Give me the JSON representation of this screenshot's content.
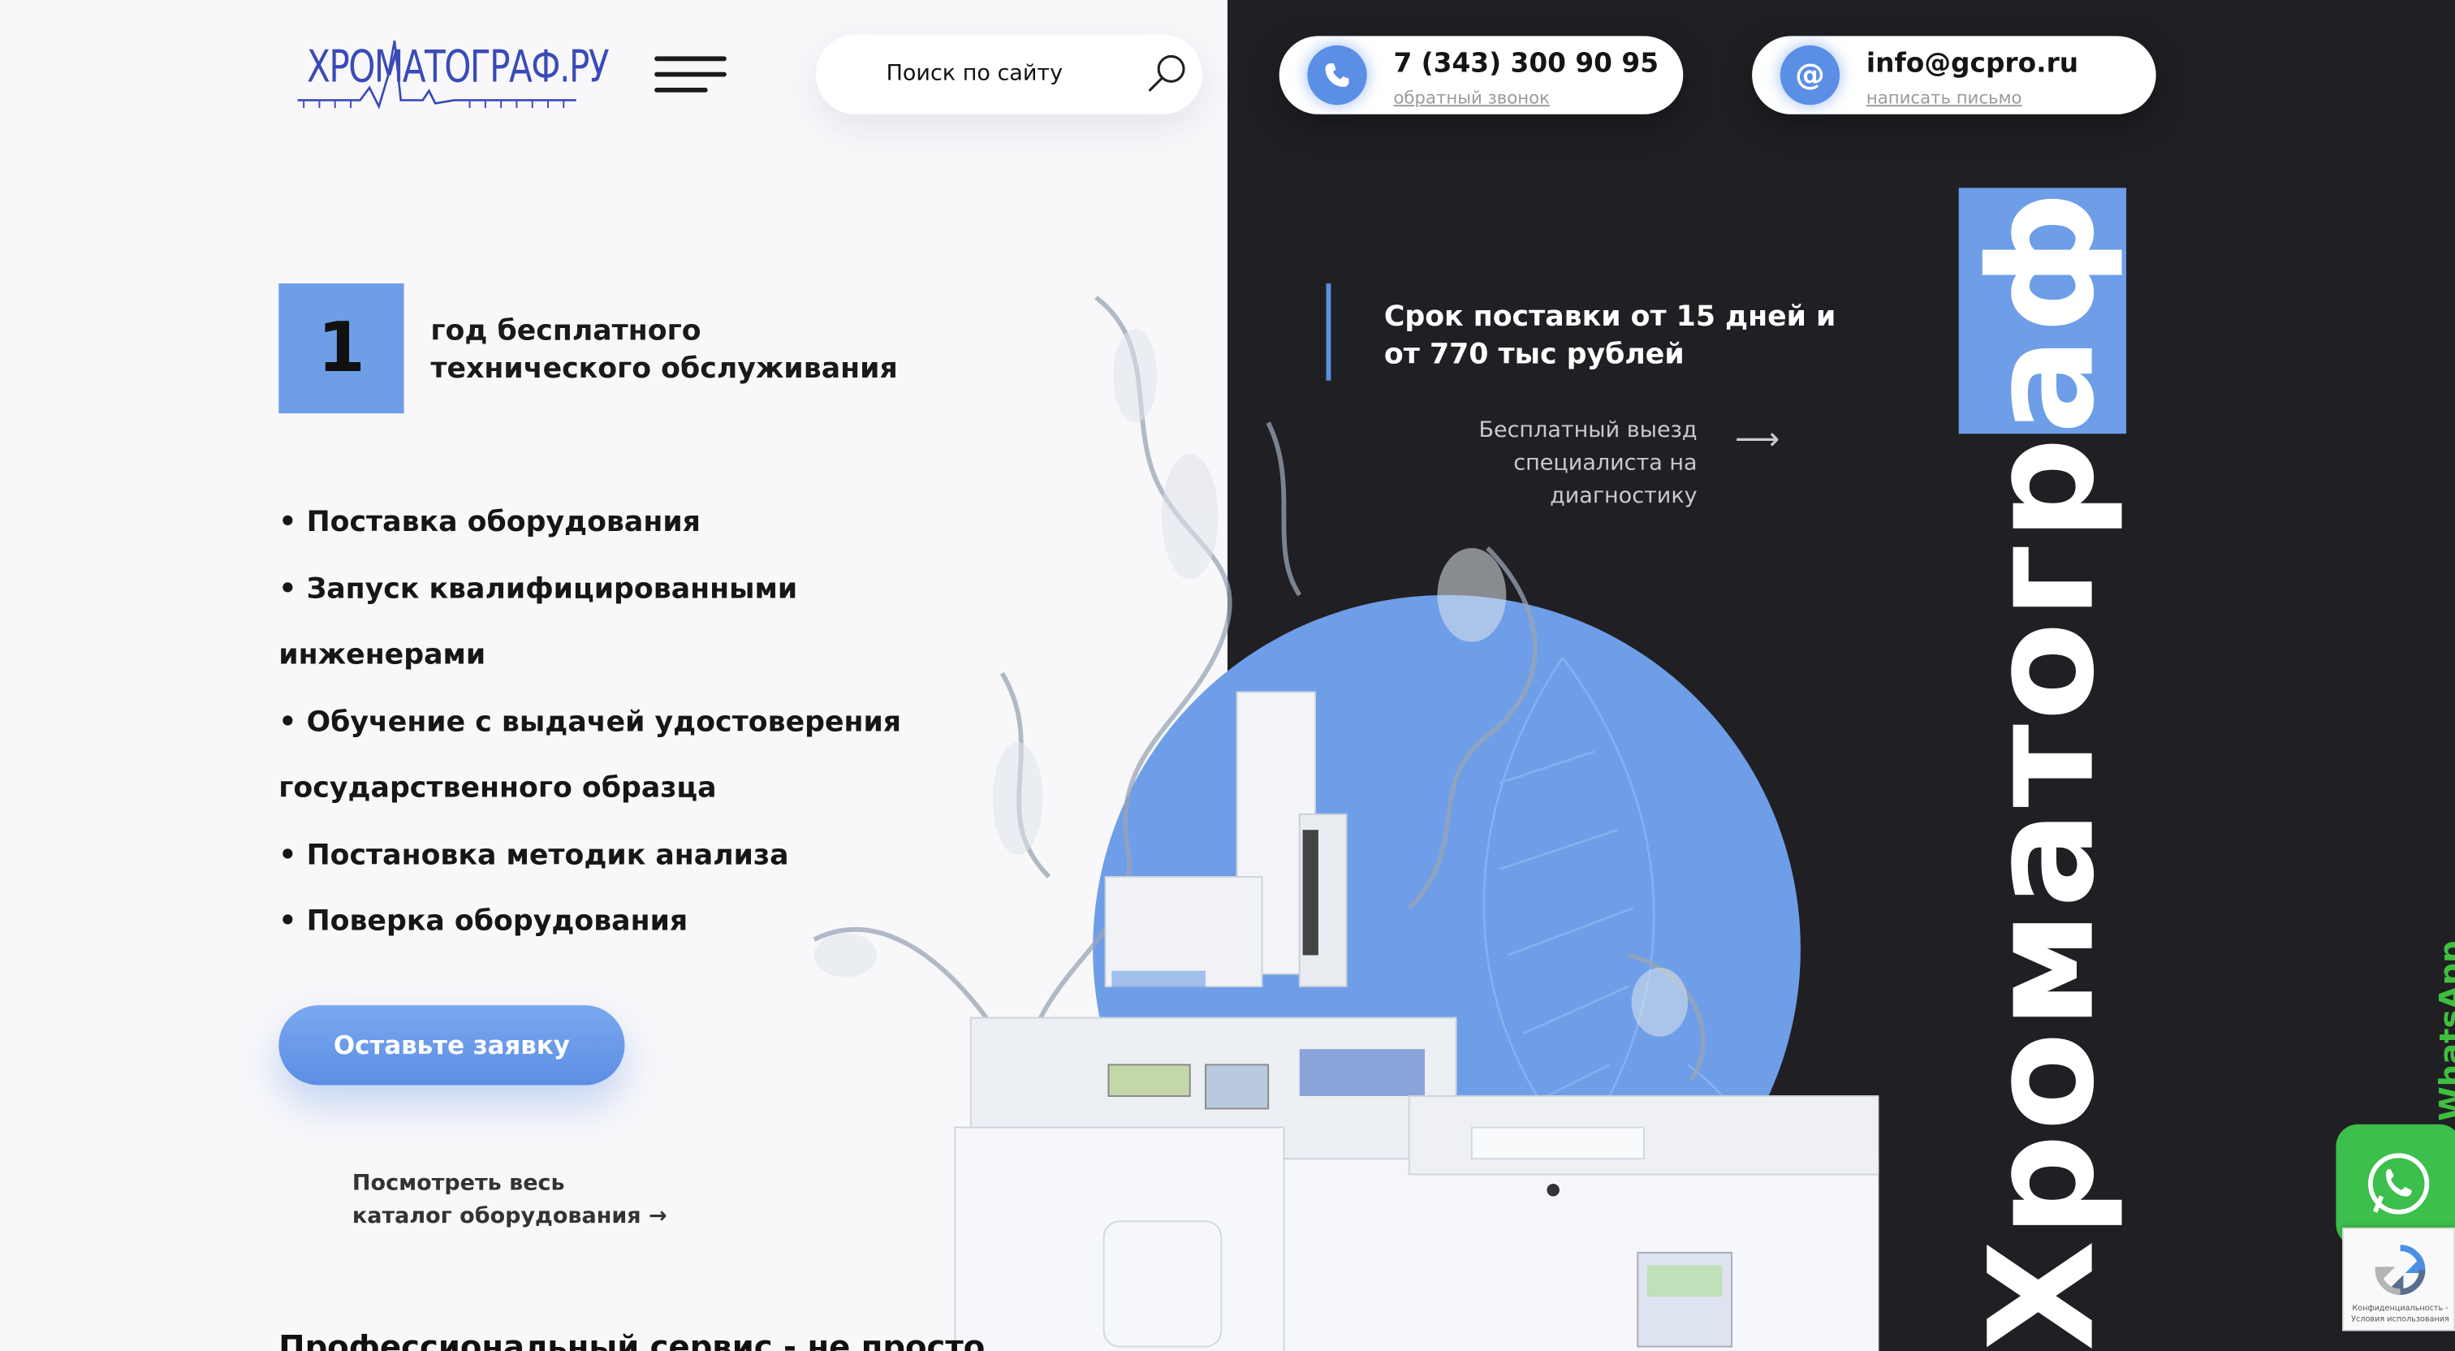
{
  "header": {
    "logo_text": "ХРОМАТОГРАФ.РУ",
    "search_placeholder": "Поиск по сайту",
    "phone": {
      "number": "7 (343) 300 90 95",
      "link": "обратный звонок"
    },
    "email": {
      "address": "info@gcpro.ru",
      "link": "написать письмо"
    }
  },
  "hero": {
    "badge_number": "1",
    "badge_text_line1": "год бесплатного",
    "badge_text_line2": "технического обслуживания",
    "features": [
      "• Поставка оборудования",
      "• Запуск квалифицированными",
      "инженерами",
      "• Обучение с выдачей удостоверения",
      "государственного образца",
      "• Постановка методик анализа",
      "• Поверка оборудования"
    ],
    "cta_label": "Оставьте заявку",
    "catalog_line1": "Посмотреть весь",
    "catalog_line2": "каталог оборудования →",
    "bottom_heading": "Профессиональный сервис - не просто"
  },
  "right": {
    "delivery_line1": "Срок поставки от 15 дней и",
    "delivery_line2": "от 770 тыс рублей",
    "visit_line1": "Бесплатный выезд",
    "visit_line2": "специалиста на диагностику",
    "vertical_prefix": "Хроматогр",
    "vertical_highlight": "аф"
  },
  "widgets": {
    "whatsapp_label": "WhatsApp",
    "recaptcha_text": "Конфиденциальность - Условия использования"
  },
  "colors": {
    "accent": "#6e9ee8",
    "dark": "#202024",
    "whatsapp": "#3cbf4c"
  }
}
